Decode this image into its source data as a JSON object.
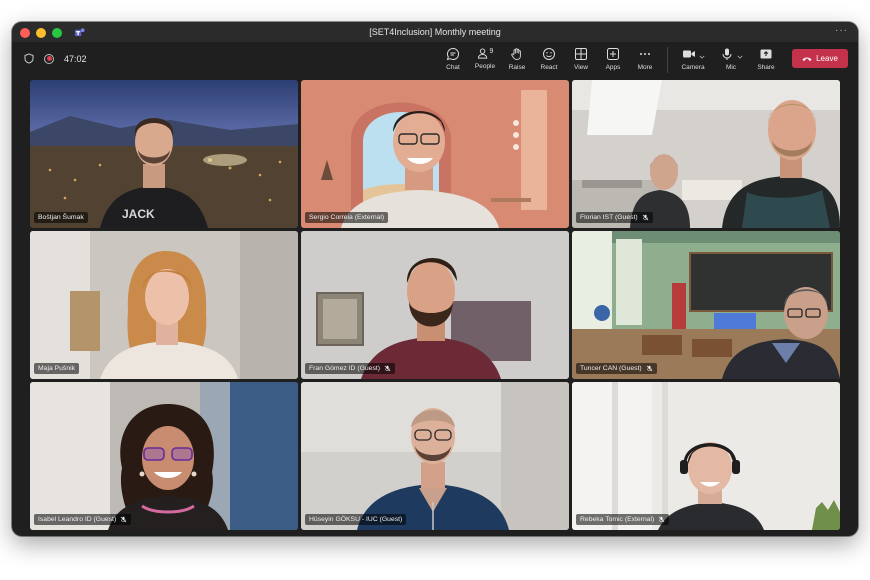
{
  "window": {
    "title": "[SET4Inclusion] Monthly meeting"
  },
  "toolbar": {
    "timer": "47:02",
    "people_count": "9",
    "tools": [
      {
        "id": "chat",
        "label": "Chat"
      },
      {
        "id": "people",
        "label": "People"
      },
      {
        "id": "raise",
        "label": "Raise"
      },
      {
        "id": "react",
        "label": "React"
      },
      {
        "id": "view",
        "label": "View"
      },
      {
        "id": "apps",
        "label": "Apps"
      },
      {
        "id": "more",
        "label": "More"
      },
      {
        "id": "camera",
        "label": "Camera"
      },
      {
        "id": "mic",
        "label": "Mic"
      },
      {
        "id": "share",
        "label": "Share"
      }
    ],
    "leave_label": "Leave"
  },
  "participants": [
    {
      "name": "Boštjan Šumak",
      "muted": false
    },
    {
      "name": "Sergio Correia (External)",
      "muted": false
    },
    {
      "name": "Florian IST (Guest)",
      "muted": true
    },
    {
      "name": "Maja Pušnik",
      "muted": false
    },
    {
      "name": "Fran Gómez ID (Guest)",
      "muted": true
    },
    {
      "name": "Tuncer CAN (Guest)",
      "muted": true
    },
    {
      "name": "Isabel Leandro ID (Guest)",
      "muted": true
    },
    {
      "name": "Hüseyin GÖKSU - IUC (Guest)",
      "muted": false
    },
    {
      "name": "Rebeka Tomic (External)",
      "muted": true
    }
  ],
  "colors": {
    "leave": "#c4314b",
    "window_bg": "#1f1f1f"
  }
}
